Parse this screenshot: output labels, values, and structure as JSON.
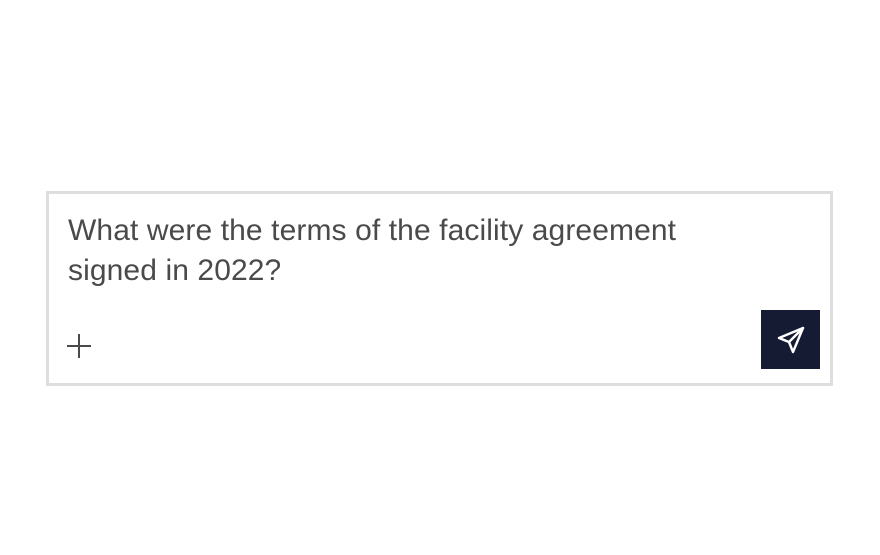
{
  "composer": {
    "prompt_text": "What were the terms of the facility agreement signed in 2022?",
    "add_icon": "plus-icon",
    "send_icon": "send-paper-plane-icon"
  },
  "colors": {
    "border": "#dedede",
    "text": "#4a4a4a",
    "send_button_bg": "#141b33",
    "send_icon": "#ffffff"
  }
}
